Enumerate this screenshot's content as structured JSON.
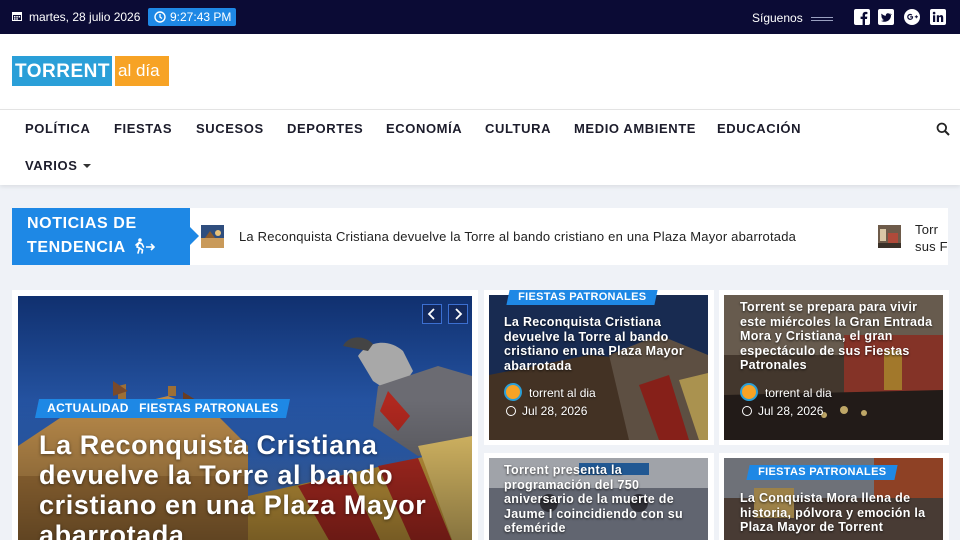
{
  "topbar": {
    "date": "martes, 28 julio 2026",
    "time": "9:27:43 PM",
    "follow_label": "Síguenos",
    "social": [
      "facebook-icon",
      "twitter-icon",
      "google-plus-icon",
      "linkedin-icon"
    ]
  },
  "logo": {
    "part1": "TORRENT",
    "part2": "al día",
    "color1": "#2a9fd8",
    "color2": "#f7a325"
  },
  "nav": {
    "items": [
      "POLÍTICA",
      "FIESTAS",
      "SUCESOS",
      "DEPORTES",
      "ECONOMÍA",
      "CULTURA",
      "MEDIO AMBIENTE",
      "EDUCACIÓN"
    ],
    "more_label": "VARIOS"
  },
  "trending": {
    "label_line1": "NOTICIAS DE",
    "label_line2": "TENDENCIA",
    "items": [
      "La Reconquista Cristiana devuelve la Torre al bando cristiano en una Plaza Mayor abarrotada",
      "Torr sus F"
    ]
  },
  "feature": {
    "categories": [
      "ACTUALIDAD",
      "FIESTAS PATRONALES"
    ],
    "title": "La Reconquista Cristiana devuelve la Torre al bando cristiano en una Plaza Mayor abarrotada"
  },
  "cards": [
    {
      "category": "FIESTAS PATRONALES",
      "title": "La Reconquista Cristiana devuelve la Torre al bando cristiano en una Plaza Mayor abarrotada",
      "author": "torrent al dia",
      "date": "Jul 28, 2026"
    },
    {
      "category": "",
      "title": "Torrent se prepara para vivir este miércoles la Gran Entrada Mora y Cristiana, el gran espectáculo de sus Fiestas Patronales",
      "author": "torrent al dia",
      "date": "Jul 28, 2026"
    },
    {
      "category": "",
      "title": "Torrent presenta la programación del 750 aniversario de la muerte de Jaume I coincidiendo con su efeméride",
      "author": "",
      "date": ""
    },
    {
      "category": "FIESTAS PATRONALES",
      "title": "La Conquista Mora llena de historia, pólvora y emoción la Plaza Mayor de Torrent",
      "author": "",
      "date": ""
    }
  ],
  "colors": {
    "topbar_bg": "#0b0b35",
    "accent": "#1e88e5"
  }
}
